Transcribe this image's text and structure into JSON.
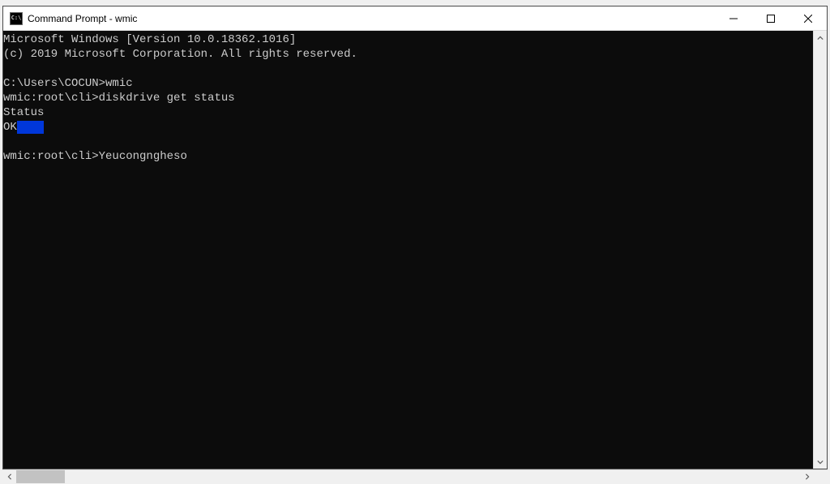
{
  "window": {
    "title": "Command Prompt - wmic",
    "icon_label": "C:\\"
  },
  "terminal": {
    "line1": "Microsoft Windows [Version 10.0.18362.1016]",
    "line2": "(c) 2019 Microsoft Corporation. All rights reserved.",
    "blank1": "",
    "prompt1_prefix": "C:\\Users\\COCUN>",
    "prompt1_cmd": "wmic",
    "prompt2_prefix": "wmic:root\\cli>",
    "prompt2_cmd": "diskdrive get status",
    "header": "Status",
    "value": "OK",
    "selection_pad": "    ",
    "blank2": "",
    "prompt3_prefix": "wmic:root\\cli>",
    "prompt3_cmd": "Yeucongngheso"
  }
}
